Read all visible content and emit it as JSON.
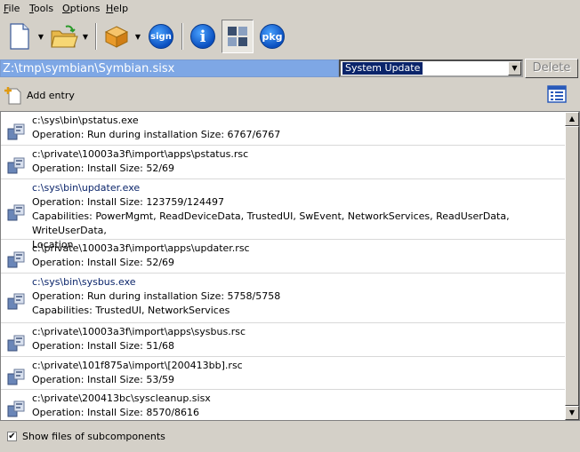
{
  "menu": {
    "items": [
      {
        "label": "File",
        "underline": "F",
        "rest": "ile"
      },
      {
        "label": "Tools",
        "underline": "T",
        "rest": "ools"
      },
      {
        "label": "Options",
        "underline": "O",
        "rest": "ptions"
      },
      {
        "label": "Help",
        "underline": "H",
        "rest": "elp"
      }
    ]
  },
  "toolbar": {
    "sign_label": "sign",
    "info_label": "i",
    "pkg_label": "pkg"
  },
  "path_field": {
    "value": "Z:\\tmp\\symbian\\Symbian.sisx"
  },
  "component_select": {
    "value": "System Update"
  },
  "delete_button": {
    "label": "Delete"
  },
  "add_entry": {
    "label": "Add entry"
  },
  "entries": [
    {
      "path": "c:\\sys\\bin\\pstatus.exe",
      "operation": "Operation: Run during installation  Size: 6767/6767",
      "caps": null
    },
    {
      "path": "c:\\private\\10003a3f\\import\\apps\\pstatus.rsc",
      "operation": "Operation: Install  Size: 52/69",
      "caps": null
    },
    {
      "path": "c:\\sys\\bin\\updater.exe",
      "operation": "Operation: Install  Size: 123759/124497",
      "caps": "Capabilities: PowerMgmt, ReadDeviceData, TrustedUI, SwEvent, NetworkServices, ReadUserData, WriteUserData,",
      "caps2": "Location"
    },
    {
      "path": "c:\\private\\10003a3f\\import\\apps\\updater.rsc",
      "operation": "Operation: Install  Size: 52/69",
      "caps": null
    },
    {
      "path": "c:\\sys\\bin\\sysbus.exe",
      "operation": "Operation: Run during installation  Size: 5758/5758",
      "caps": "Capabilities: TrustedUI, NetworkServices"
    },
    {
      "path": "c:\\private\\10003a3f\\import\\apps\\sysbus.rsc",
      "operation": "Operation: Install  Size: 51/68",
      "caps": null
    },
    {
      "path": "c:\\private\\101f875a\\import\\[200413bb].rsc",
      "operation": "Operation: Install  Size: 53/59",
      "caps": null
    },
    {
      "path": "c:\\private\\200413bc\\syscleanup.sisx",
      "operation": "Operation: Install  Size: 8570/8616",
      "caps": null
    }
  ],
  "footer": {
    "show_subcomponents_label": "Show files of subcomponents",
    "checked": true
  },
  "colors": {
    "accent": "#0a246a",
    "path_bg": "#7ea7e5",
    "face": "#d4d0c8"
  }
}
